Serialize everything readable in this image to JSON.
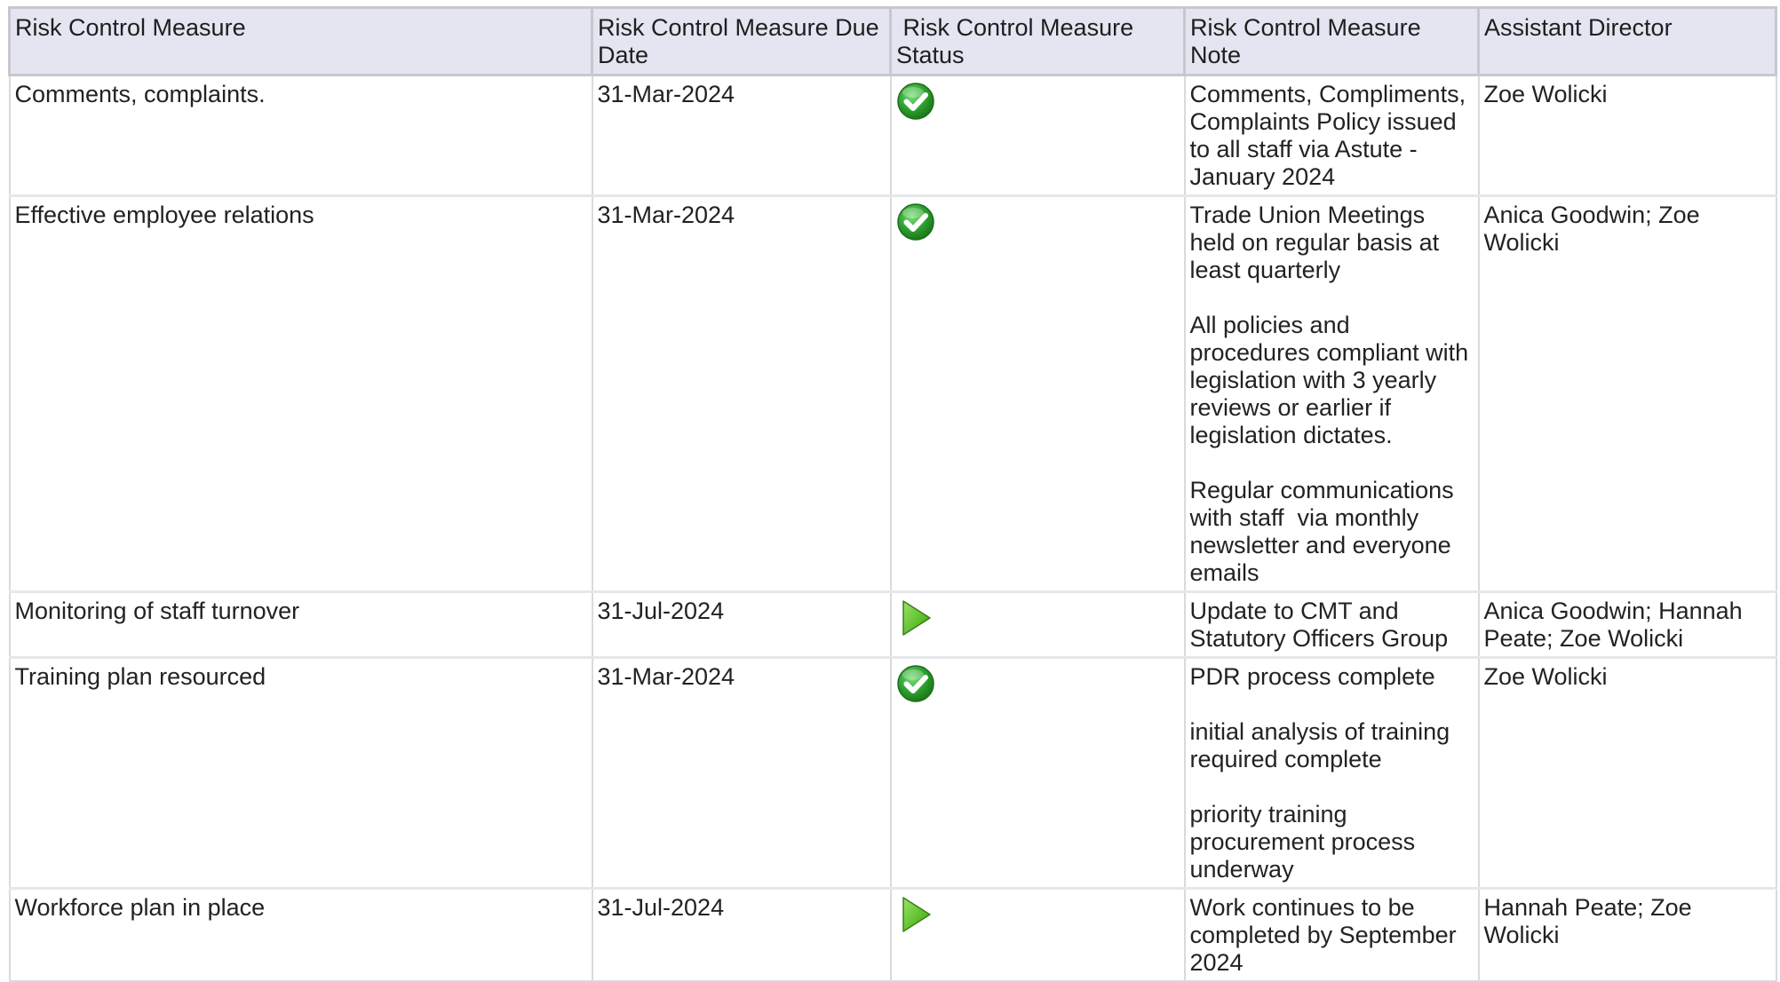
{
  "table": {
    "headers": [
      "Risk Control Measure",
      "Risk Control Measure Due Date",
      " Risk Control Measure Status",
      "Risk Control Measure Note",
      "Assistant Director"
    ],
    "rows": [
      {
        "measure": "Comments, complaints.",
        "due_date": "31-Mar-2024",
        "status_icon": "check-complete-icon",
        "note": [
          "Comments, Compliments, Complaints Policy issued to all staff via Astute - January 2024"
        ],
        "director": "Zoe Wolicki"
      },
      {
        "measure": "Effective employee relations",
        "due_date": "31-Mar-2024",
        "status_icon": "check-complete-icon",
        "note": [
          "Trade Union Meetings held on regular basis at least quarterly",
          "All policies and procedures compliant with legislation with 3 yearly reviews or earlier if legislation dictates.",
          "Regular communications with staff  via monthly newsletter and everyone emails"
        ],
        "director": "Anica Goodwin; Zoe Wolicki"
      },
      {
        "measure": "Monitoring of staff turnover",
        "due_date": "31-Jul-2024",
        "status_icon": "play-in-progress-icon",
        "note": [
          "Update to CMT and Statutory Officers Group"
        ],
        "director": "Anica Goodwin; Hannah Peate; Zoe Wolicki"
      },
      {
        "measure": "Training plan resourced",
        "due_date": "31-Mar-2024",
        "status_icon": "check-complete-icon",
        "note": [
          "PDR process complete",
          "initial analysis of training required complete",
          "priority training procurement process underway"
        ],
        "director": "Zoe Wolicki"
      },
      {
        "measure": "Workforce plan in place",
        "due_date": "31-Jul-2024",
        "status_icon": "play-in-progress-icon",
        "note": [
          "Work continues to be completed by September 2024"
        ],
        "director": "Hannah Peate; Zoe Wolicki"
      }
    ]
  },
  "colors": {
    "header_bg": "#e4e5f1",
    "check_green": "#2ea02e",
    "play_green": "#5cbf2a"
  }
}
